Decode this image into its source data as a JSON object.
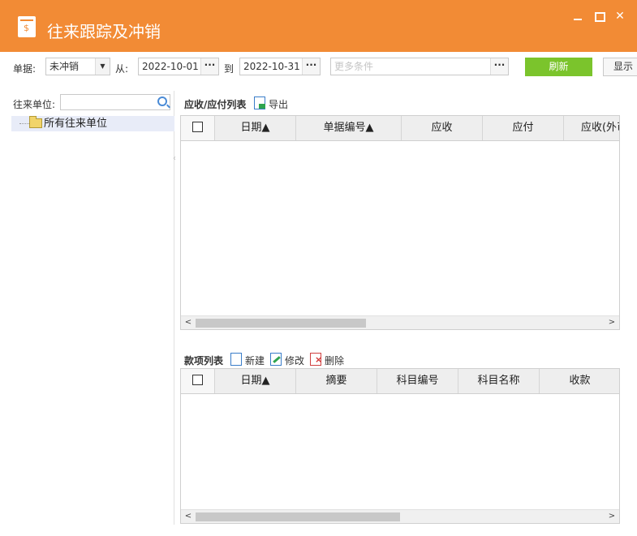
{
  "window": {
    "title": "往来跟踪及冲销",
    "title_icon": "ledger-icon",
    "accent": "#f28b35"
  },
  "toolbar": {
    "doc_label": "单据:",
    "doc_value": "未冲销",
    "from_label": "从:",
    "from_value": "2022-10-01",
    "to_label": "到",
    "to_value": "2022-10-31",
    "more_placeholder": "更多条件",
    "refresh_label": "刷新",
    "show_label": "显示",
    "refresh_color": "#7bc42c"
  },
  "left": {
    "unit_label": "往来单位:",
    "tree_root": "所有往来单位"
  },
  "ar_ap": {
    "title": "应收/应付列表",
    "export_label": "导出",
    "columns": [
      "日期▲",
      "单据编号▲",
      "应收",
      "应付",
      "应收(外币"
    ]
  },
  "payments": {
    "title": "款项列表",
    "new_label": "新建",
    "edit_label": "修改",
    "delete_label": "删除",
    "columns": [
      "日期▲",
      "摘要",
      "科目编号",
      "科目名称",
      "收款"
    ]
  }
}
